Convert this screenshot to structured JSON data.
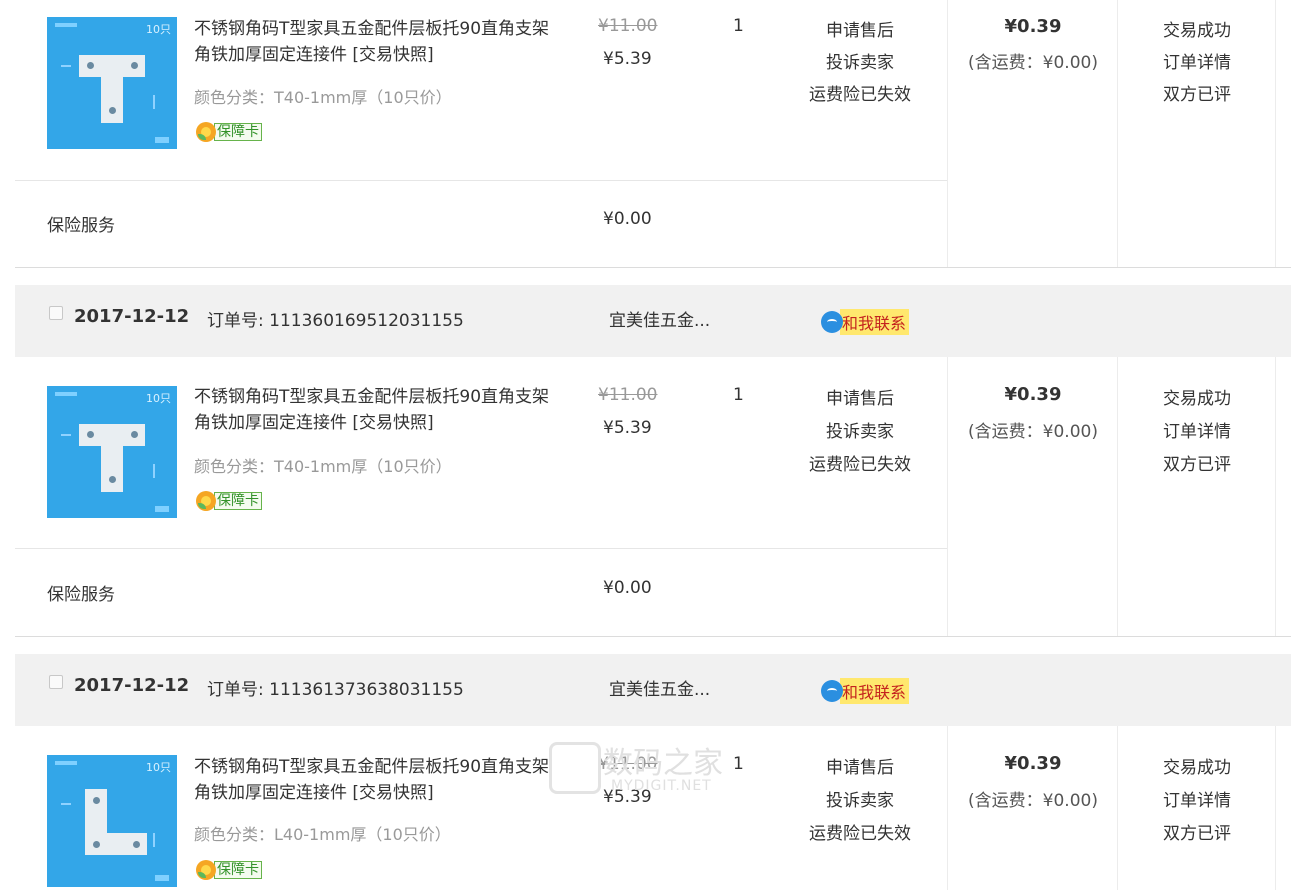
{
  "orders": [
    {
      "header": null,
      "product": {
        "title": "不锈钢角码T型家具五金配件层板托90直角支架角铁加厚固定连接件 [交易快照]",
        "sku": "颜色分类：T40-1mm厚（10只价）",
        "shape": "T",
        "badge": "保障卡",
        "thumb_label": "10只",
        "original_price": "¥11.00",
        "price": "¥5.39",
        "quantity": "1",
        "actions": [
          "申请售后",
          "投诉卖家",
          "运费险已失效"
        ]
      },
      "total": "¥0.39",
      "shipping_note": "(含运费：¥0.00)",
      "status": [
        "交易成功",
        "订单详情",
        "双方已评"
      ],
      "insurance": {
        "label": "保险服务",
        "price": "¥0.00"
      }
    },
    {
      "header": {
        "date": "2017-12-12",
        "order_no": "订单号: 111360169512031155",
        "shop": "宜美佳五金...",
        "contact": "和我联系"
      },
      "product": {
        "title": "不锈钢角码T型家具五金配件层板托90直角支架角铁加厚固定连接件 [交易快照]",
        "sku": "颜色分类：T40-1mm厚（10只价）",
        "shape": "T",
        "badge": "保障卡",
        "thumb_label": "10只",
        "original_price": "¥11.00",
        "price": "¥5.39",
        "quantity": "1",
        "actions": [
          "申请售后",
          "投诉卖家",
          "运费险已失效"
        ]
      },
      "total": "¥0.39",
      "shipping_note": "(含运费：¥0.00)",
      "status": [
        "交易成功",
        "订单详情",
        "双方已评"
      ],
      "insurance": {
        "label": "保险服务",
        "price": "¥0.00"
      }
    },
    {
      "header": {
        "date": "2017-12-12",
        "order_no": "订单号: 111361373638031155",
        "shop": "宜美佳五金...",
        "contact": "和我联系"
      },
      "product": {
        "title": "不锈钢角码T型家具五金配件层板托90直角支架角铁加厚固定连接件 [交易快照]",
        "sku": "颜色分类：L40-1mm厚（10只价）",
        "shape": "L",
        "badge": "保障卡",
        "thumb_label": "10只",
        "original_price": "¥11.00",
        "price": "¥5.39",
        "quantity": "1",
        "actions": [
          "申请售后",
          "投诉卖家",
          "运费险已失效"
        ]
      },
      "total": "¥0.39",
      "shipping_note": "(含运费：¥0.00)",
      "status": [
        "交易成功",
        "订单详情",
        "双方已评"
      ]
    }
  ],
  "watermark": {
    "title": "数码之家",
    "site": "MYDIGIT.NET"
  },
  "colors": {
    "header_bg": "#f1f1f1",
    "thumb_bg": "#33a6e8",
    "contact_bg": "#ffe86e",
    "contact_text": "#c4221e",
    "badge_green": "#33922a"
  }
}
